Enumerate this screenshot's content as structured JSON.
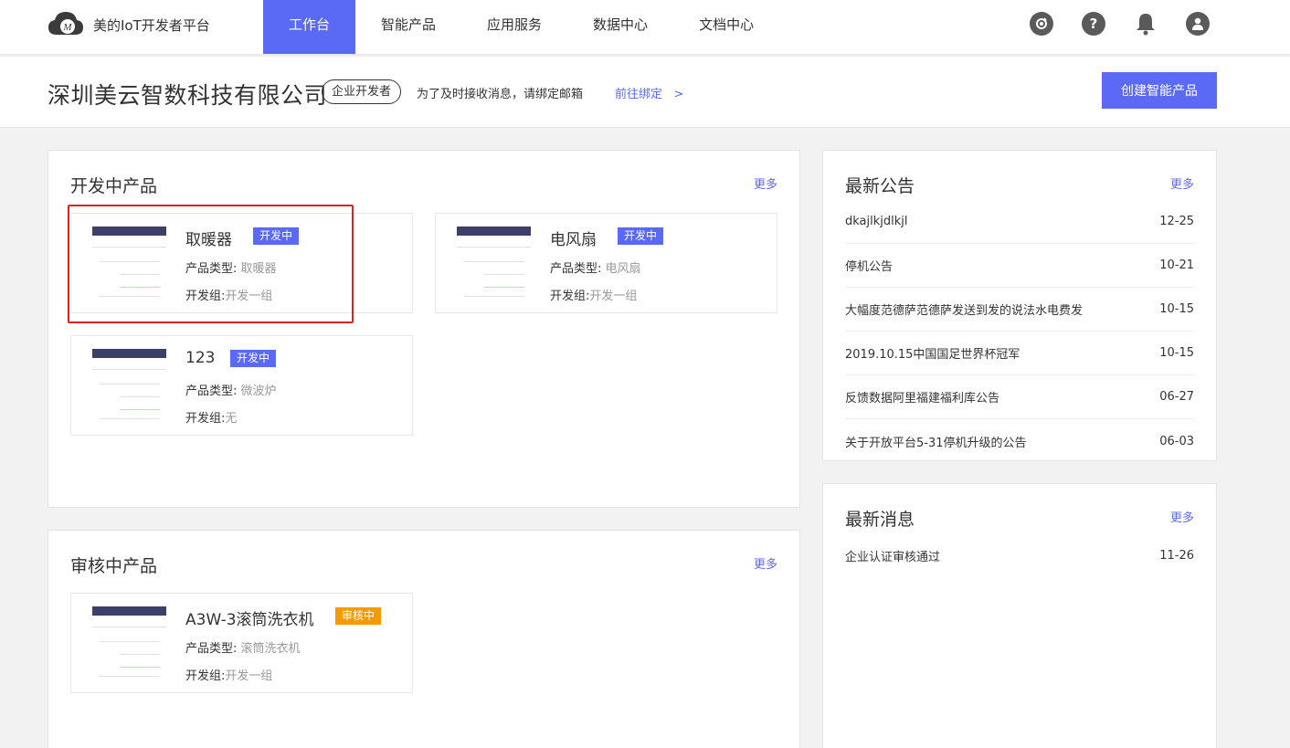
{
  "header": {
    "brand": "美的IoT开发者平台",
    "nav": [
      "工作台",
      "智能产品",
      "应用服务",
      "数据中心",
      "文档中心"
    ],
    "active_nav": 0,
    "icon_names": [
      "refresh-icon",
      "help-icon",
      "bell-icon",
      "user-icon"
    ]
  },
  "company": {
    "name": "深圳美云智数科技有限公司",
    "role": "企业开发者",
    "bind_tip": "为了及时接收消息，请绑定邮箱",
    "bind_link": "前往绑定   >",
    "create_button": "创建智能产品"
  },
  "dev_products": {
    "title": "开发中产品",
    "more": "更多",
    "type_label": "产品类型:",
    "group_label": "开发组:",
    "items": [
      {
        "name": "取暖器",
        "status": "开发中",
        "type": " 取暖器",
        "group": "开发一组"
      },
      {
        "name": "电风扇",
        "status": "开发中",
        "type": " 电风扇",
        "group": "开发一组"
      },
      {
        "name": "123",
        "status": "开发中",
        "type": " 微波炉",
        "group": "无"
      }
    ]
  },
  "review_products": {
    "title": "审核中产品",
    "more": "更多",
    "type_label": "产品类型:",
    "group_label": "开发组:",
    "items": [
      {
        "name": "A3W-3滚筒洗衣机",
        "status": "审核中",
        "type": " 滚筒洗衣机",
        "group": "开发一组"
      }
    ]
  },
  "announcements": {
    "title": "最新公告",
    "more": "更多",
    "items": [
      {
        "title": "dkajlkjdlkjl",
        "date": "12-25"
      },
      {
        "title": "停机公告",
        "date": "10-21"
      },
      {
        "title": "大幅度范德萨范德萨发送到发的说法水电费发",
        "date": "10-15"
      },
      {
        "title": "2019.10.15中国国足世界杯冠军",
        "date": "10-15"
      },
      {
        "title": "反馈数据阿里福建福利库公告",
        "date": "06-27"
      },
      {
        "title": "关于开放平台5-31停机升级的公告",
        "date": "06-03"
      }
    ]
  },
  "messages": {
    "title": "最新消息",
    "more": "更多",
    "items": [
      {
        "title": "企业认证审核通过",
        "date": "11-26"
      }
    ]
  },
  "colors": {
    "accent": "#5b6af5",
    "review": "#f59a00",
    "highlight": "#e32020"
  }
}
